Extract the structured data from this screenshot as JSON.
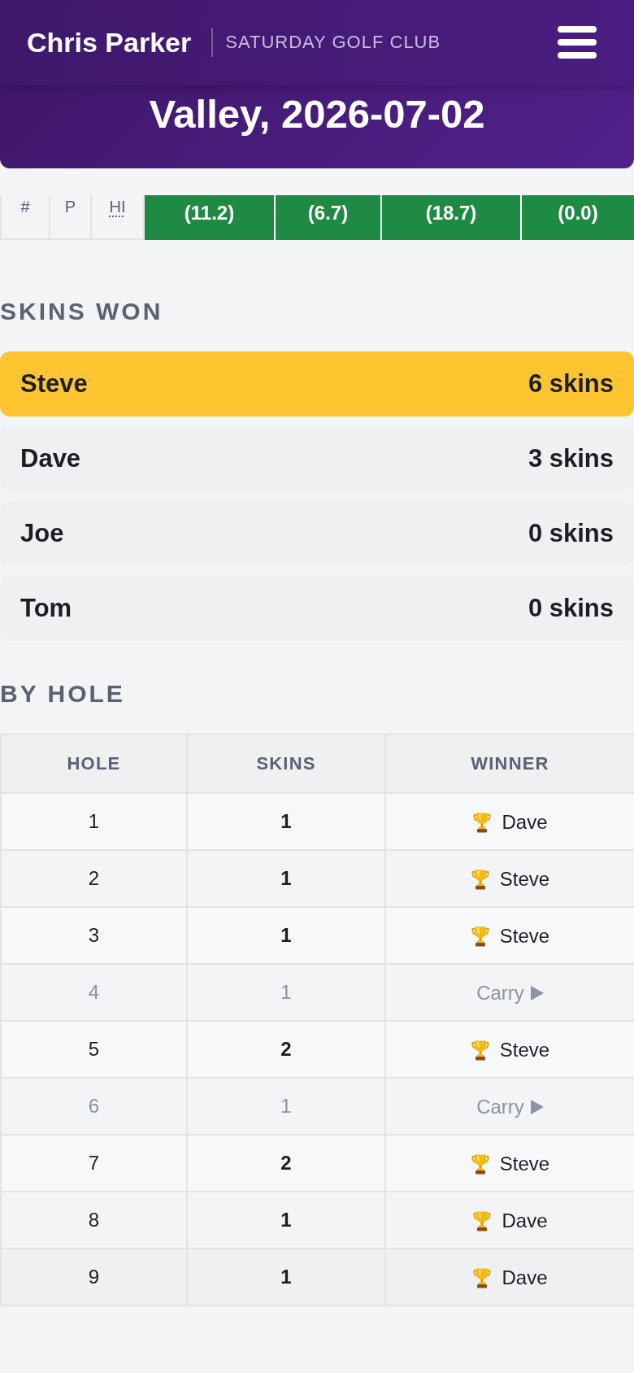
{
  "header": {
    "user": "Chris Parker",
    "club": "SATURDAY GOLF CLUB",
    "title": "Valley, 2026-07-02"
  },
  "scorecard": {
    "labels": [
      {
        "text": "#",
        "abbreviation": false
      },
      {
        "text": "P",
        "abbreviation": false
      },
      {
        "text": "HI",
        "abbreviation": true
      }
    ],
    "handicaps": [
      "(11.2)",
      "(6.7)",
      "(18.7)",
      "(0.0)"
    ]
  },
  "skins_won": {
    "heading": "SKINS WON",
    "players": [
      {
        "name": "Steve",
        "skins": "6 skins",
        "leader": true
      },
      {
        "name": "Dave",
        "skins": "3 skins",
        "leader": false
      },
      {
        "name": "Joe",
        "skins": "0 skins",
        "leader": false
      },
      {
        "name": "Tom",
        "skins": "0 skins",
        "leader": false
      }
    ]
  },
  "by_hole": {
    "heading": "BY HOLE",
    "columns": [
      "HOLE",
      "SKINS",
      "WINNER"
    ],
    "rows": [
      {
        "hole": "1",
        "skins": "1",
        "kind": "won",
        "winner": "Dave"
      },
      {
        "hole": "2",
        "skins": "1",
        "kind": "won",
        "winner": "Steve"
      },
      {
        "hole": "3",
        "skins": "1",
        "kind": "won",
        "winner": "Steve"
      },
      {
        "hole": "4",
        "skins": "1",
        "kind": "carry",
        "winner": "Carry"
      },
      {
        "hole": "5",
        "skins": "2",
        "kind": "won",
        "winner": "Steve"
      },
      {
        "hole": "6",
        "skins": "1",
        "kind": "carry",
        "winner": "Carry"
      },
      {
        "hole": "7",
        "skins": "2",
        "kind": "won",
        "winner": "Steve"
      },
      {
        "hole": "8",
        "skins": "1",
        "kind": "won",
        "winner": "Dave"
      },
      {
        "hole": "9",
        "skins": "1",
        "kind": "won",
        "winner": "Dave"
      }
    ]
  }
}
